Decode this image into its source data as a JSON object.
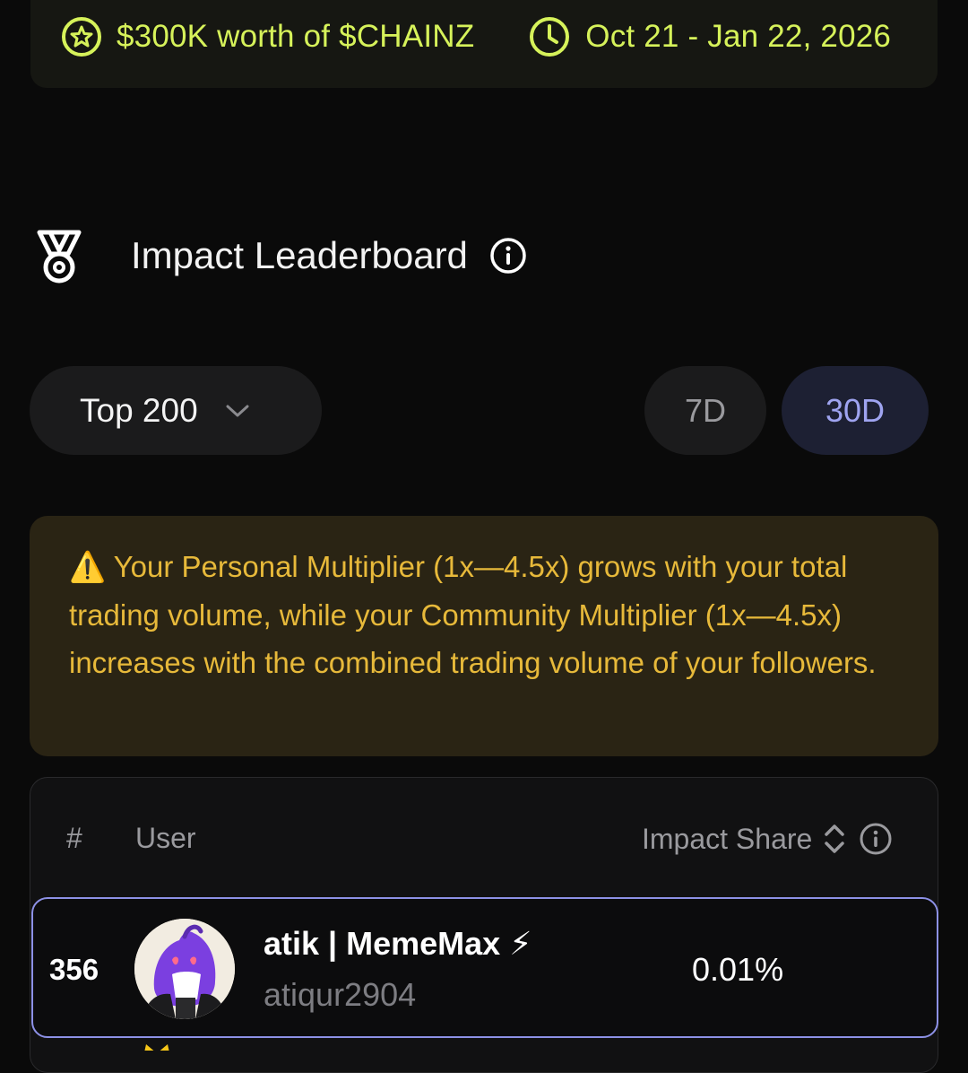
{
  "banner": {
    "reward": "$300K worth of $CHAINZ",
    "dates": "Oct 21 - Jan 22, 2026",
    "accent": "#d6f25a"
  },
  "leaderboard": {
    "title": "Impact Leaderboard",
    "filter_selected": "Top 200",
    "periods": [
      "7D",
      "30D"
    ],
    "active_period": "30D"
  },
  "notice": {
    "icon": "⚠️",
    "text": "Your Personal Multiplier (1x—4.5x) grows with your total trading volume, while your Community Multiplier (1x—4.5x) increases with the combined trading volume of your followers."
  },
  "table": {
    "headers": {
      "rank": "#",
      "user": "User",
      "impact": "Impact Share"
    },
    "rows": [
      {
        "rank": "356",
        "name": "atik | MemeMax",
        "badge": "⚡",
        "handle": "atiqur2904",
        "share": "0.01%"
      }
    ]
  }
}
